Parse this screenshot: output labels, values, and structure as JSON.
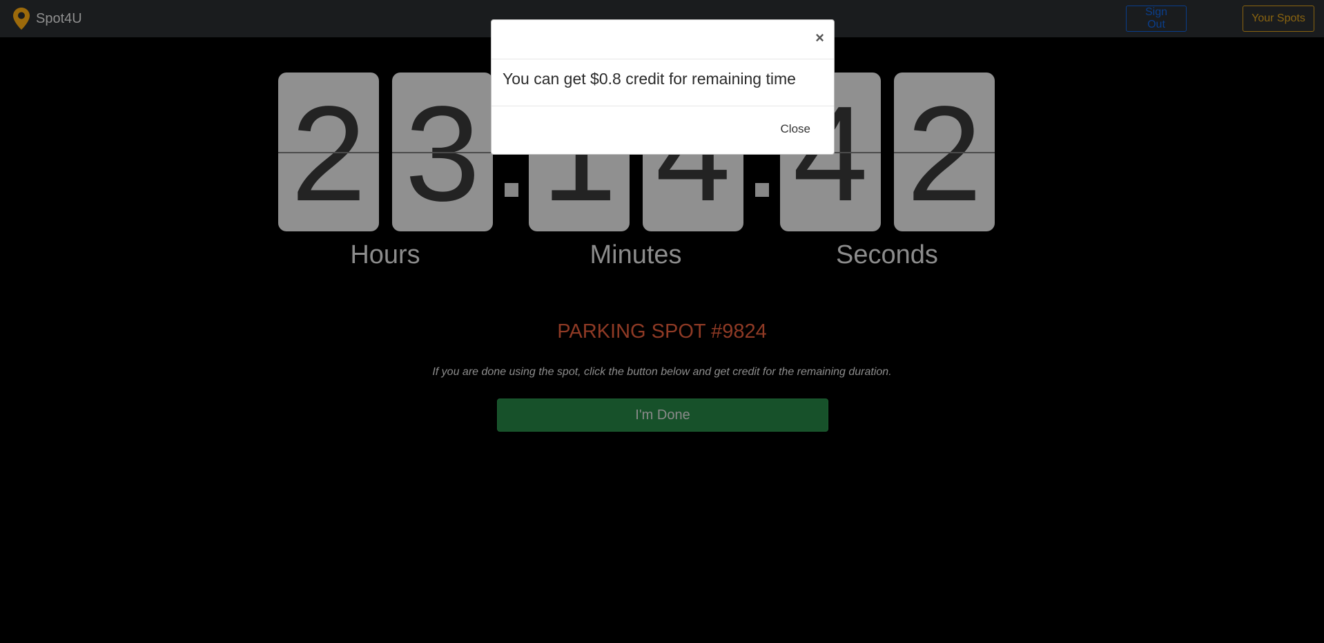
{
  "navbar": {
    "brand": "Spot4U",
    "sign_out": "Sign Out",
    "your_spots": "Your Spots"
  },
  "countdown": {
    "hours": [
      "2",
      "3"
    ],
    "minutes": [
      "1",
      "4"
    ],
    "seconds": [
      "4",
      "2"
    ],
    "labels": {
      "hours": "Hours",
      "minutes": "Minutes",
      "seconds": "Seconds"
    }
  },
  "spot": {
    "title": "PARKING SPOT #9824",
    "instruction": "If you are done using the spot, click the button below and get credit for the remaining duration.",
    "done_button": "I'm Done"
  },
  "modal": {
    "close_x": "×",
    "message": "You can get $0.8 credit for remaining time",
    "close_button": "Close"
  },
  "colors": {
    "navbar_bg": "#1a1c1e",
    "brand_icon": "#9c6a0b",
    "card_bg": "#909090",
    "spot_title": "#8f3a25",
    "done_button": "#17512a"
  },
  "icons": {
    "brand": "map-pin-icon"
  }
}
